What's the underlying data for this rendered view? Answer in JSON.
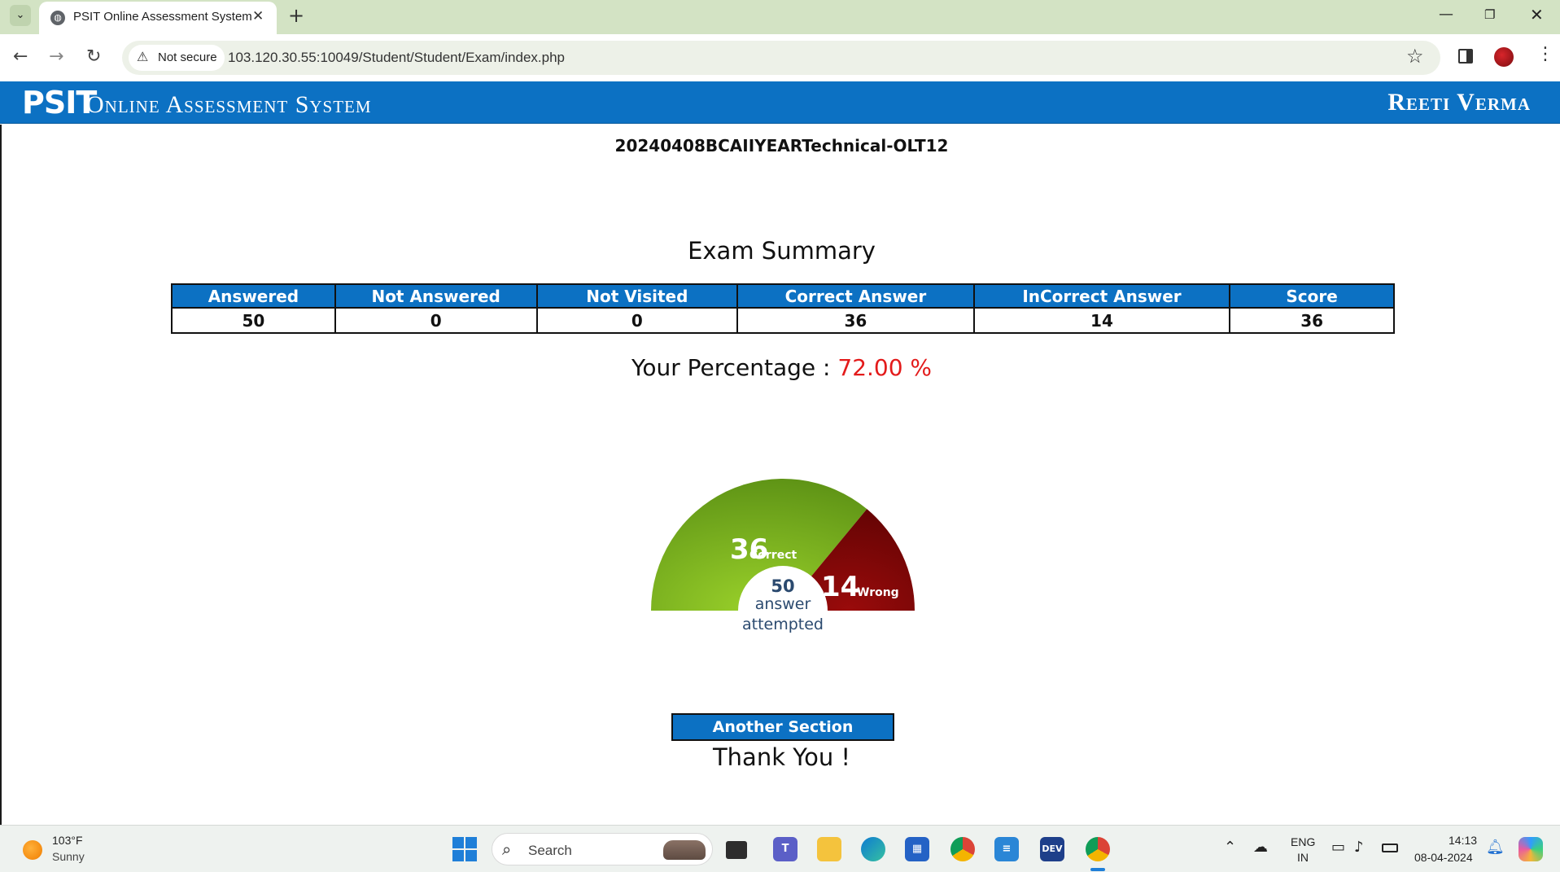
{
  "browser": {
    "tab_title": "PSIT Online Assessment System",
    "security_label": "Not secure",
    "url": "103.120.30.55:10049/Student/Student/Exam/index.php"
  },
  "header": {
    "brand_bold": "PSIT",
    "brand_sub": "Online Assessment System",
    "user_name": "Reeti Verma"
  },
  "exam": {
    "code": "20240408BCAIIYEARTechnical-OLT12",
    "summary_title": "Exam Summary",
    "table": {
      "headers": [
        "Answered",
        "Not Answered",
        "Not Visited",
        "Correct Answer",
        "InCorrect Answer",
        "Score"
      ],
      "values": [
        "50",
        "0",
        "0",
        "36",
        "14",
        "36"
      ]
    },
    "percentage_label": "Your Percentage :",
    "percentage_value": "72.00 %",
    "gauge": {
      "correct_value": "36",
      "correct_label": "Correct",
      "wrong_value": "14",
      "wrong_label": "Wrong",
      "center_value": "50",
      "center_line1": "answer",
      "center_line2": "attempted",
      "correct_count": 36,
      "wrong_count": 14,
      "total": 50,
      "colors": {
        "correct": "#6ba51f",
        "wrong": "#7a0606",
        "center_text": "#2b4a6f"
      }
    },
    "another_section_label": "Another Section",
    "thank_you": "Thank You !"
  },
  "taskbar": {
    "weather_temp": "103°F",
    "weather_desc": "Sunny",
    "search_label": "Search",
    "lang_line1": "ENG",
    "lang_line2": "IN",
    "time": "14:13",
    "date": "08-04-2024"
  },
  "colors": {
    "brand_blue": "#0c71c3",
    "percentage_red": "#e31b1b"
  }
}
